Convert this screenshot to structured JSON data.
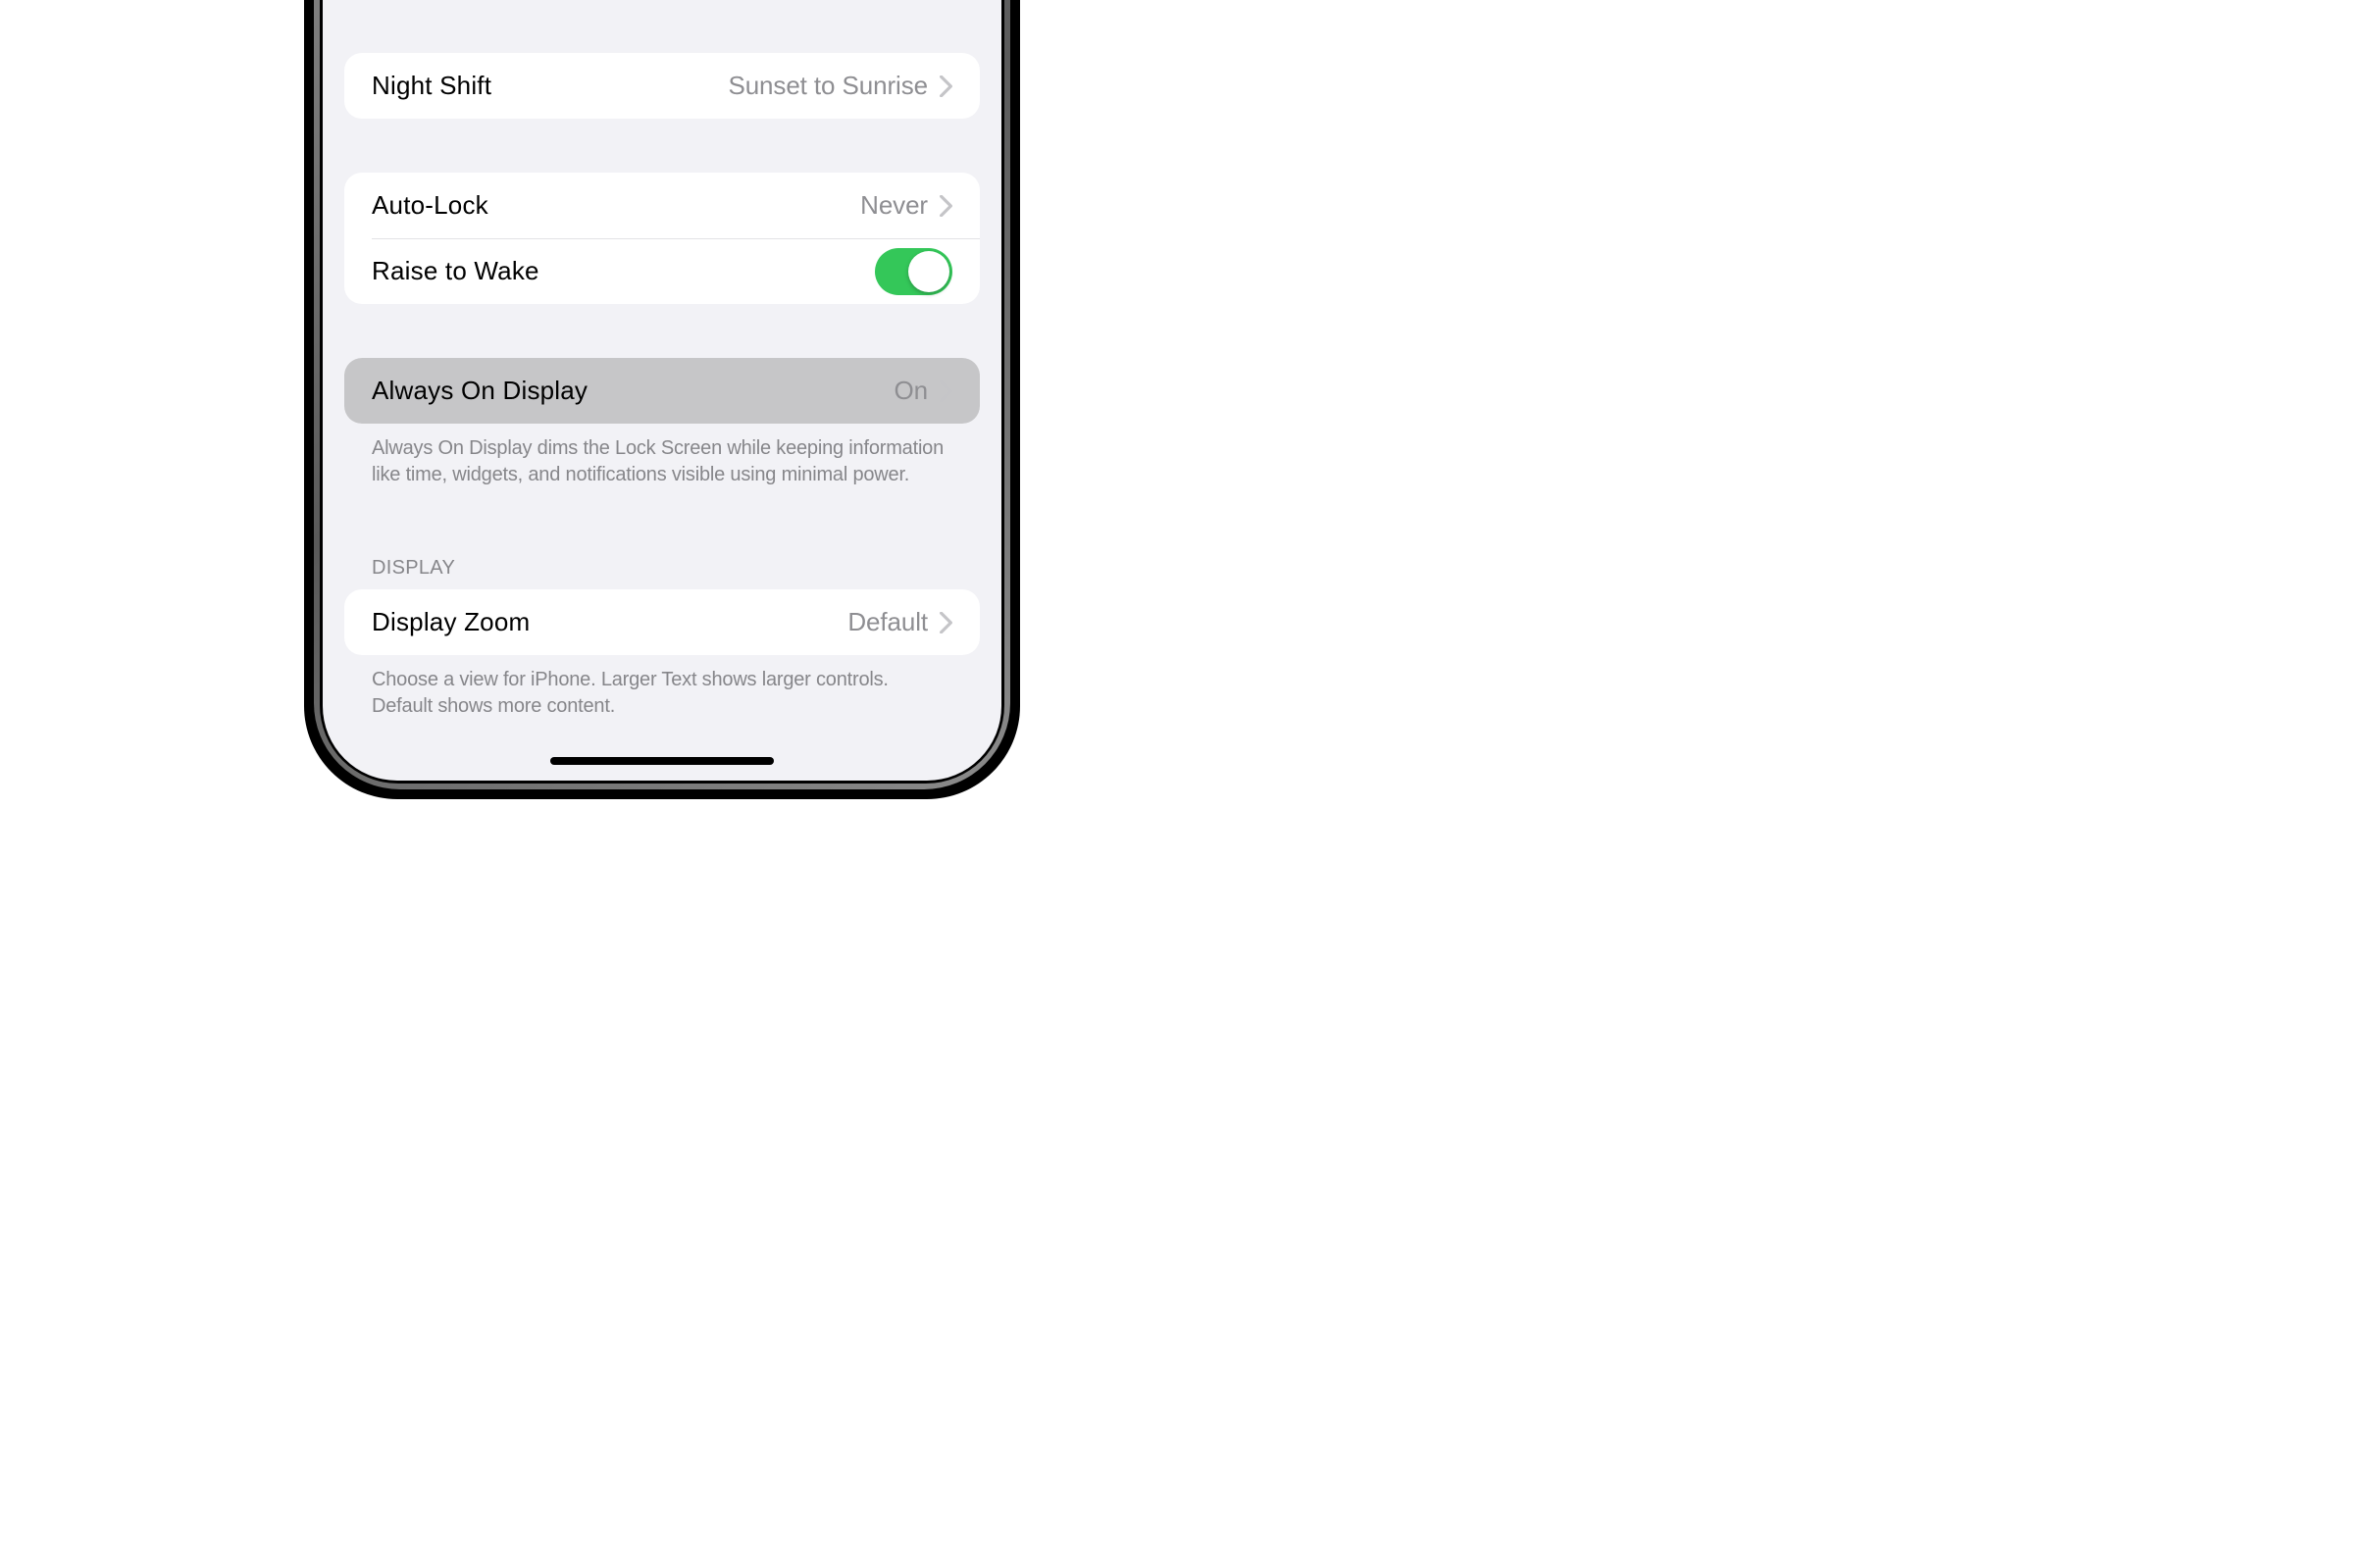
{
  "groups": {
    "night_shift": {
      "label": "Night Shift",
      "value": "Sunset to Sunrise"
    },
    "lock": {
      "auto_lock_label": "Auto-Lock",
      "auto_lock_value": "Never",
      "raise_to_wake_label": "Raise to Wake",
      "raise_to_wake_on": true
    },
    "aod": {
      "label": "Always On Display",
      "value": "On",
      "footer": "Always On Display dims the Lock Screen while keeping information like time, widgets, and notifications visible using minimal power."
    },
    "display": {
      "header": "DISPLAY",
      "zoom_label": "Display Zoom",
      "zoom_value": "Default",
      "footer": "Choose a view for iPhone. Larger Text shows larger controls. Default shows more content."
    }
  }
}
